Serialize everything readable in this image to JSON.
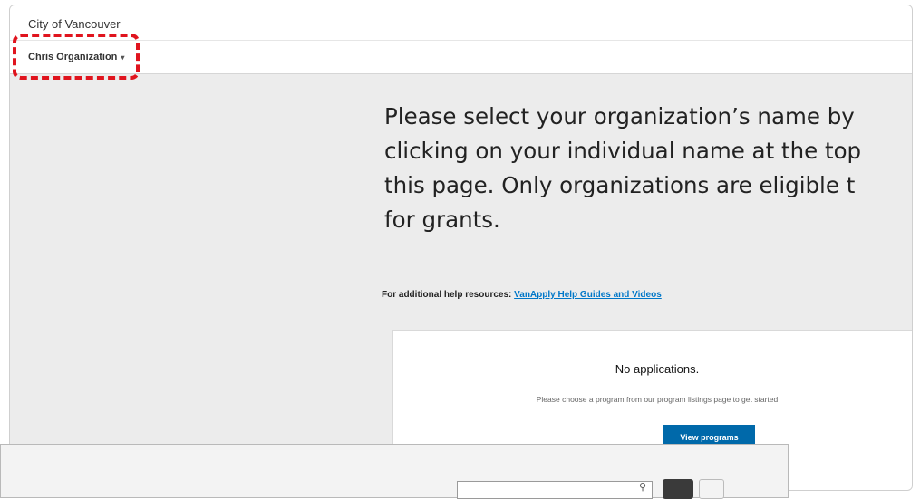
{
  "header": {
    "site_name": "City of Vancouver",
    "org_switcher_label": "Chris Organization"
  },
  "main": {
    "heading_lines": [
      "Please select your organization’s name by",
      "clicking on your individual name at the top",
      "this page. Only organizations are eligible t",
      "for grants."
    ],
    "help_prefix": "For additional help resources: ",
    "help_link_text": "VanApply Help Guides and Videos"
  },
  "card": {
    "title": "No applications.",
    "subtitle": "Please choose a program from our program listings page to get started",
    "button_label": "View programs"
  },
  "colors": {
    "highlight": "#e0141e",
    "link": "#0077c8",
    "primary_button": "#0069aa"
  }
}
